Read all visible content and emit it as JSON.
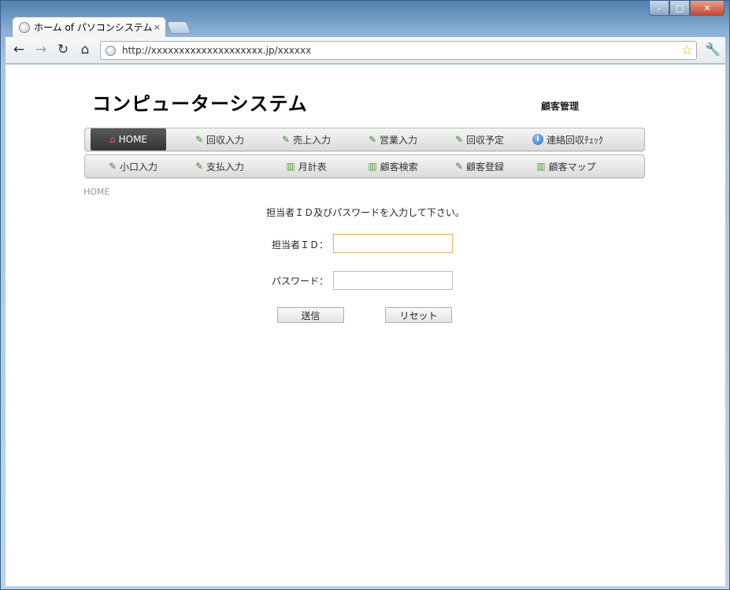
{
  "browser": {
    "tab_title": "ホーム of パソコンシステム",
    "tab_close": "×",
    "url": "http://xxxxxxxxxxxxxxxxxxxx.jp/xxxxxx",
    "nav": {
      "back": "←",
      "forward": "→",
      "reload": "↻",
      "home": "⌂"
    },
    "bookmark_star": "☆",
    "menu_wrench": "🔧",
    "window": {
      "minimize": "–",
      "maximize": "□",
      "close": "✕"
    }
  },
  "header": {
    "title": "コンピューターシステム",
    "subtitle": "顧客管理"
  },
  "menu": {
    "row1": [
      {
        "label": "HOME",
        "icon": "home-icon"
      },
      {
        "label": "回収入力",
        "icon": "pen-icon"
      },
      {
        "label": "売上入力",
        "icon": "pen-icon"
      },
      {
        "label": "営業入力",
        "icon": "pen-icon"
      },
      {
        "label": "回収予定",
        "icon": "pen-icon"
      },
      {
        "label": "連絡回収ﾁｪｯｸ",
        "icon": "info-icon"
      }
    ],
    "row2": [
      {
        "label": "小口入力",
        "icon": "pen-icon"
      },
      {
        "label": "支払入力",
        "icon": "pen-icon"
      },
      {
        "label": "月計表",
        "icon": "chart-icon"
      },
      {
        "label": "顧客検索",
        "icon": "chart-icon"
      },
      {
        "label": "顧客登録",
        "icon": "pen-icon"
      },
      {
        "label": "顧客マップ",
        "icon": "chart-icon"
      }
    ]
  },
  "breadcrumb": "HOME",
  "login": {
    "instruction": "担当者ＩＤ及びパスワードを入力して下さい。",
    "id_label": "担当者ＩＤ：",
    "id_value": "",
    "password_label": "パスワード：",
    "password_value": "",
    "submit_label": "送信",
    "reset_label": "リセット"
  },
  "colors": {
    "active_menu": "#3f3f3f",
    "focus_border": "#e3b86a",
    "frame": "#6f97bf"
  }
}
